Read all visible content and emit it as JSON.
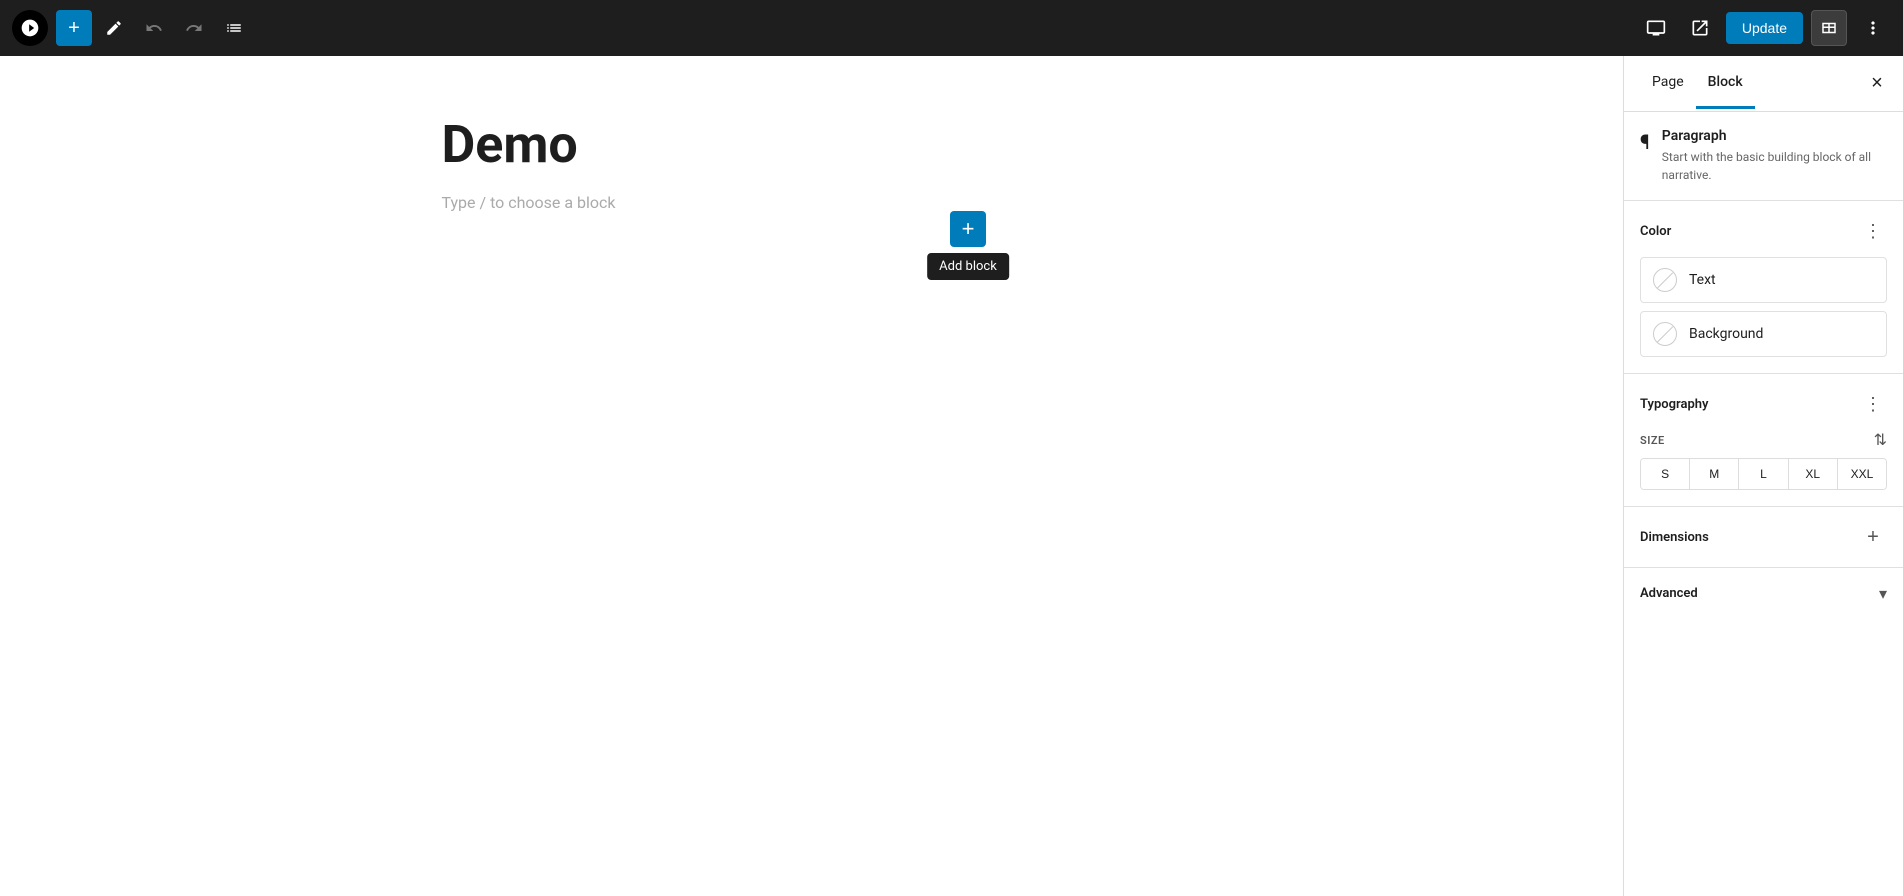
{
  "toolbar": {
    "add_label": "+",
    "update_label": "Update",
    "undo_icon": "undo",
    "redo_icon": "redo",
    "list_icon": "list",
    "edit_icon": "edit",
    "view_icon": "view",
    "external_icon": "external",
    "more_icon": "more",
    "square_view_icon": "square"
  },
  "editor": {
    "title": "Demo",
    "placeholder": "Type / to choose a block",
    "add_block_tooltip": "Add block"
  },
  "sidebar": {
    "tabs": [
      {
        "label": "Page",
        "active": false
      },
      {
        "label": "Block",
        "active": true
      }
    ],
    "close_icon": "×",
    "paragraph": {
      "title": "Paragraph",
      "description": "Start with the basic building block of all narrative."
    },
    "color": {
      "section_title": "Color",
      "options": [
        {
          "label": "Text"
        },
        {
          "label": "Background"
        }
      ]
    },
    "typography": {
      "section_title": "Typography",
      "size_label": "SIZE",
      "sizes": [
        "S",
        "M",
        "L",
        "XL",
        "XXL"
      ]
    },
    "dimensions": {
      "section_title": "Dimensions"
    },
    "advanced": {
      "section_title": "Advanced"
    }
  }
}
